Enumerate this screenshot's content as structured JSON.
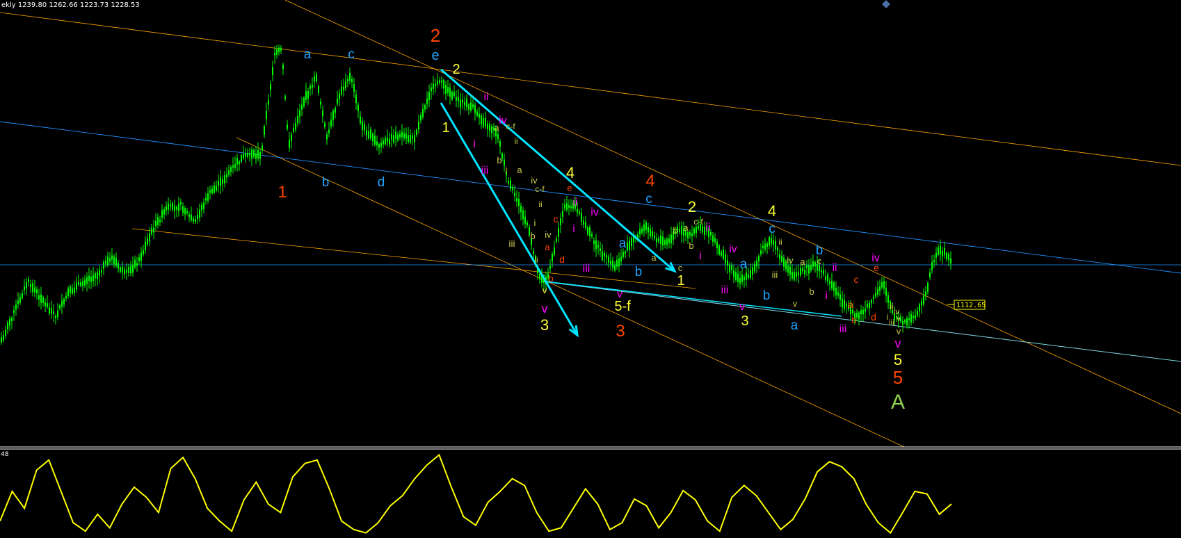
{
  "chart_header": {
    "ohlc_text": "ekly  1239.80 1262.66 1223.73 1228.53"
  },
  "indicator_header": {
    "text": "48"
  },
  "price_tag": {
    "value": "1112.65"
  },
  "colors": {
    "background": "#000000",
    "candle": "#00ff00",
    "orange_line": "#ffa500",
    "blue_line": "#1e90ff",
    "cyan_arrow": "#00e5ff",
    "oscillator": "#ffff00",
    "wave_red": "#ff4500",
    "wave_blue": "#1fa3ff",
    "wave_yellow": "#ffff33",
    "wave_magenta": "#ff00ff",
    "wave_olive": "#c8c84a",
    "wave_green": "#8fd14f"
  },
  "chart_data": [
    {
      "type": "candlestick",
      "title": "",
      "note": "price series with Elliott-wave annotations",
      "visible_values": [
        "1239.80",
        "1262.66",
        "1223.73",
        "1228.53",
        "1112.65"
      ],
      "wave_labels": [
        "1",
        "2",
        "3",
        "4",
        "5",
        "A",
        "a",
        "b",
        "c",
        "d",
        "e",
        "i",
        "ii",
        "iii",
        "iv",
        "v",
        "5-f",
        "c-f"
      ]
    },
    {
      "type": "line",
      "title": "",
      "series": [
        {
          "values": [
            20,
            55,
            35,
            80,
            92,
            55,
            18,
            8,
            28,
            12,
            40,
            60,
            48,
            30,
            82,
            95,
            70,
            35,
            20,
            8,
            45,
            66,
            40,
            30,
            72,
            88,
            92,
            58,
            20,
            10,
            6,
            18,
            38,
            50,
            70,
            86,
            98,
            60,
            25,
            15,
            42,
            55,
            70,
            62,
            30,
            8,
            12,
            35,
            58,
            40,
            10,
            18,
            46,
            38,
            12,
            30,
            56,
            45,
            20,
            8,
            48,
            62,
            50,
            30,
            10,
            22,
            46,
            78,
            90,
            84,
            70,
            40,
            18,
            6,
            30,
            55,
            52,
            28,
            40
          ]
        }
      ]
    }
  ]
}
